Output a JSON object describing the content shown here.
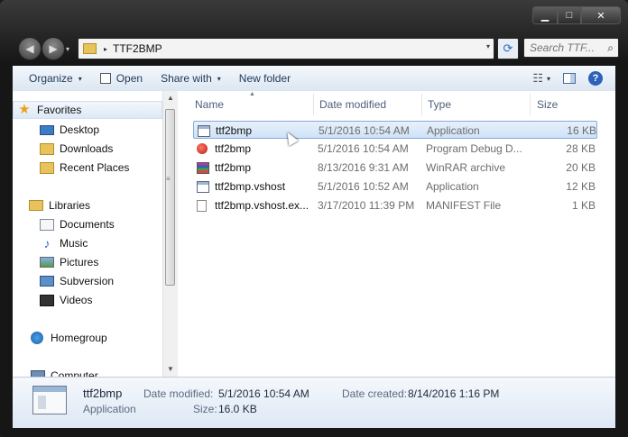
{
  "window": {
    "minimize": "▁",
    "maximize": "□",
    "close": "✕"
  },
  "address": {
    "path": "TTF2BMP",
    "separator": "▸",
    "dropdown": "▾"
  },
  "search": {
    "placeholder": "Search TTF..."
  },
  "toolbar": {
    "organize": "Organize",
    "open": "Open",
    "share_with": "Share with",
    "new_folder": "New folder",
    "caret": "▾",
    "help": "?"
  },
  "nav": {
    "favorites": "Favorites",
    "desktop": "Desktop",
    "downloads": "Downloads",
    "recent_places": "Recent Places",
    "libraries": "Libraries",
    "documents": "Documents",
    "music": "Music",
    "pictures": "Pictures",
    "subversion": "Subversion",
    "videos": "Videos",
    "homegroup": "Homegroup",
    "computer": "Computer"
  },
  "columns": {
    "name": "Name",
    "date_modified": "Date modified",
    "type": "Type",
    "size": "Size"
  },
  "files": [
    {
      "name": "ttf2bmp",
      "date": "5/1/2016 10:54 AM",
      "type": "Application",
      "size": "16 KB",
      "icon": "application-icon",
      "selected": true
    },
    {
      "name": "ttf2bmp",
      "date": "5/1/2016 10:54 AM",
      "type": "Program Debug D...",
      "size": "28 KB",
      "icon": "debug-database-icon",
      "selected": false
    },
    {
      "name": "ttf2bmp",
      "date": "8/13/2016 9:31 AM",
      "type": "WinRAR archive",
      "size": "20 KB",
      "icon": "winrar-archive-icon",
      "selected": false
    },
    {
      "name": "ttf2bmp.vshost",
      "date": "5/1/2016 10:52 AM",
      "type": "Application",
      "size": "12 KB",
      "icon": "application-icon",
      "selected": false
    },
    {
      "name": "ttf2bmp.vshost.ex...",
      "date": "3/17/2010 11:39 PM",
      "type": "MANIFEST File",
      "size": "1 KB",
      "icon": "manifest-file-icon",
      "selected": false
    }
  ],
  "details": {
    "name": "ttf2bmp",
    "type": "Application",
    "date_modified_label": "Date modified:",
    "date_modified": "5/1/2016 10:54 AM",
    "date_created_label": "Date created:",
    "date_created": "8/14/2016 1:16 PM",
    "size_label": "Size:",
    "size": "16.0 KB"
  }
}
